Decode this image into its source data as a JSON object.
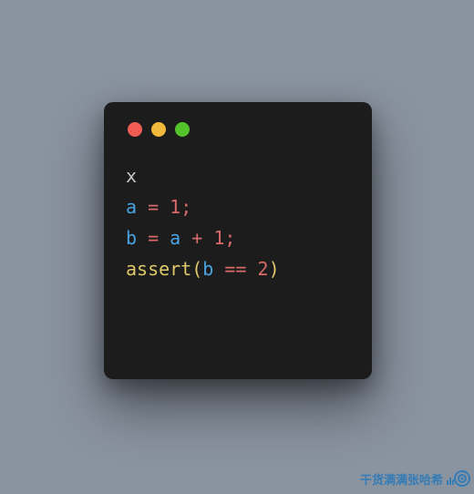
{
  "window": {
    "traffic_lights": {
      "close_color": "#ee5c54",
      "minimize_color": "#f1b93c",
      "zoom_color": "#54c22b"
    }
  },
  "code": {
    "line1": {
      "x": "x"
    },
    "line2": {
      "a": "a",
      "eq": " = ",
      "n1": "1",
      "sc": ";"
    },
    "line3": {
      "b": "b",
      "eq": " = ",
      "a": "a",
      "plus": " + ",
      "n1": "1",
      "sc": ";"
    },
    "line4": {
      "fn": "assert",
      "lp": "(",
      "b": "b",
      "eq": " == ",
      "n2": "2",
      "rp": ")"
    }
  },
  "watermark": {
    "text": "干货满满张哈希"
  }
}
